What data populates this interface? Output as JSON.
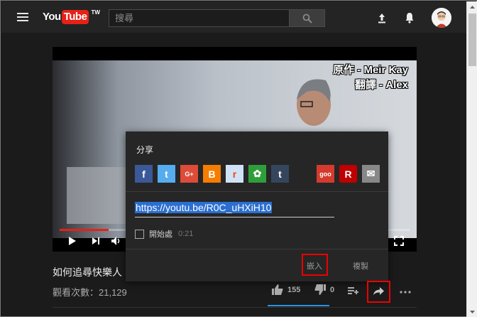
{
  "header": {
    "logo_you": "You",
    "logo_tube": "Tube",
    "logo_region": "TW",
    "search_placeholder": "搜尋"
  },
  "video": {
    "subtitle_line1": "原作 - Meir Kay",
    "subtitle_line2": "翻譯 - Alex",
    "progress_fraction": 0.14
  },
  "info": {
    "title": "如何追尋快樂人",
    "views": "觀看次數：21,129",
    "likes": "155",
    "dislikes": "0"
  },
  "share_dialog": {
    "title": "分享",
    "socials": [
      {
        "name": "facebook",
        "glyph": "f",
        "color": "#3b5998"
      },
      {
        "name": "twitter",
        "glyph": "t",
        "color": "#55acee"
      },
      {
        "name": "google-plus",
        "glyph": "G+",
        "color": "#dd4b39"
      },
      {
        "name": "blogger",
        "glyph": "B",
        "color": "#f57d00"
      },
      {
        "name": "reddit",
        "glyph": "r",
        "color": "#cee3f8"
      },
      {
        "name": "plurk",
        "glyph": "✿",
        "color": "#2e9e3b"
      },
      {
        "name": "tumblr",
        "glyph": "t",
        "color": "#35465c"
      },
      {
        "name": "goo",
        "glyph": "goo",
        "color": "#d43b2e"
      },
      {
        "name": "rakuten",
        "glyph": "R",
        "color": "#bf0000"
      },
      {
        "name": "email",
        "glyph": "✉",
        "color": "#888888"
      }
    ],
    "url": "https://youtu.be/R0C_uHXiH10",
    "start_label": "開始處",
    "start_time": "0:21",
    "embed_label": "嵌入",
    "copy_label": "複製"
  },
  "colors": {
    "accent_red": "#e62117",
    "highlight_blue": "#2793e6",
    "annotation_red": "#ee0000"
  }
}
